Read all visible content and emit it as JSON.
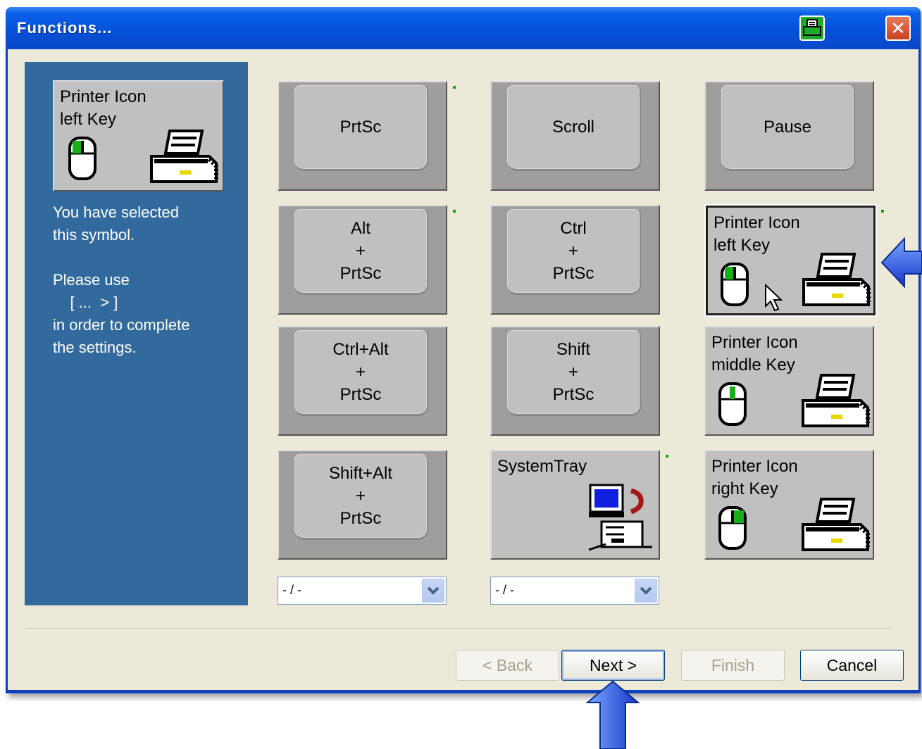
{
  "window": {
    "title": "Functions...",
    "close_symbol": "✕"
  },
  "left_panel": {
    "selected_symbol_label": [
      "Printer Icon",
      "left Key"
    ],
    "info": [
      "You have selected",
      "this symbol.",
      "",
      "Please use",
      "    [ ...  > ]",
      "in order to complete",
      "the settings."
    ]
  },
  "keys": [
    {
      "id": "prtsc",
      "lines": [
        "PrtSc"
      ]
    },
    {
      "id": "scroll",
      "lines": [
        "Scroll"
      ]
    },
    {
      "id": "pause",
      "lines": [
        "Pause"
      ]
    },
    {
      "id": "alt-prtsc",
      "lines": [
        "Alt",
        "+",
        "PrtSc"
      ]
    },
    {
      "id": "ctrl-prtsc",
      "lines": [
        "Ctrl",
        "+",
        "PrtSc"
      ]
    },
    {
      "id": "printer-left",
      "lines": [
        "Printer Icon",
        "left Key"
      ]
    },
    {
      "id": "ctrl-alt-prtsc",
      "lines": [
        "Ctrl+Alt",
        "+",
        "PrtSc"
      ]
    },
    {
      "id": "shift-prtsc",
      "lines": [
        "Shift",
        "+",
        "PrtSc"
      ]
    },
    {
      "id": "printer-middle",
      "lines": [
        "Printer Icon",
        "middle Key"
      ]
    },
    {
      "id": "shift-alt-prtsc",
      "lines": [
        "Shift+Alt",
        "+",
        "PrtSc"
      ]
    },
    {
      "id": "systemtray",
      "lines": [
        "SystemTray"
      ]
    },
    {
      "id": "printer-right",
      "lines": [
        "Printer Icon",
        "right Key"
      ]
    }
  ],
  "dropdowns": [
    {
      "value": "- / -"
    },
    {
      "value": "- / -"
    }
  ],
  "buttons": {
    "back": "< Back",
    "next": "Next >",
    "finish": "Finish",
    "cancel": "Cancel"
  },
  "colors": {
    "panel": "#336a9e",
    "accent_arrow": "#1a4bd8"
  }
}
